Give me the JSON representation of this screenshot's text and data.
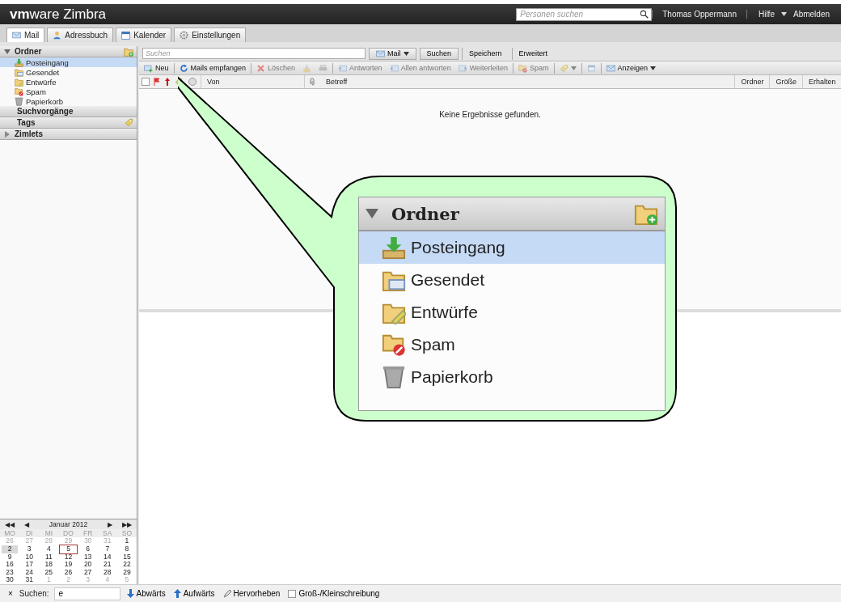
{
  "header": {
    "logo": "**vm**ware Zimbra",
    "people_search": {
      "placeholder": "Personen suchen"
    },
    "user": "Thomas Oppermann",
    "help": "Hilfe",
    "logout": "Abmelden"
  },
  "app_tabs": [
    {
      "label": "Mail",
      "selected": true
    },
    {
      "label": "Adressbuch",
      "selected": false
    },
    {
      "label": "Kalender",
      "selected": false
    },
    {
      "label": "Einstellungen",
      "selected": false
    }
  ],
  "sidebar": {
    "folders_header": {
      "label": "Ordner",
      "expanded": true
    },
    "folders": [
      {
        "label": "Posteingang",
        "selected": true
      },
      {
        "label": "Gesendet",
        "selected": false
      },
      {
        "label": "Entwürfe",
        "selected": false
      },
      {
        "label": "Spam",
        "selected": false
      },
      {
        "label": "Papierkorb",
        "selected": false
      }
    ],
    "sections": [
      {
        "label": "Suchvorgänge",
        "kind": "plain"
      },
      {
        "label": "Tags",
        "kind": "tags"
      },
      {
        "label": "Zimlets",
        "kind": "collapsed"
      }
    ]
  },
  "search": {
    "placeholder": "Suchen",
    "scope": "Mail",
    "buttons": [
      "Suchen",
      "Speichern",
      "Erweitert"
    ]
  },
  "toolbar": [
    {
      "label": "Neu",
      "disabled": false
    },
    {
      "label": "Mails empfangen",
      "disabled": false
    },
    {
      "label": "Löschen",
      "disabled": true
    },
    {
      "disabled": true
    },
    {
      "disabled": true
    },
    {
      "label": "Antworten",
      "disabled": true
    },
    {
      "label": "Allen antworten",
      "disabled": true
    },
    {
      "label": "Weiterleiten",
      "disabled": true
    },
    {
      "label": "Spam",
      "disabled": true
    },
    {
      "disabled": true
    },
    {
      "disabled": true
    },
    {
      "label": "Anzeigen",
      "disabled": false
    }
  ],
  "select_all": {
    "checked": false
  },
  "columns": [
    "Von",
    "Betreff",
    "Ordner",
    "Größe",
    "Erhalten"
  ],
  "empty_message": "Keine Ergebnisse gefunden.",
  "calendar": {
    "nav": [
      "◀◀",
      "◀",
      "▶",
      "▶▶"
    ],
    "title": "Januar 2012",
    "weekdays": [
      "MO",
      "DI",
      "MI",
      "DO",
      "FR",
      "SA",
      "SO"
    ],
    "weeks": [
      [
        {
          "day": "26",
          "other_month": true,
          "today": false,
          "selected": false
        },
        {
          "day": "27",
          "other_month": true,
          "today": false,
          "selected": false
        },
        {
          "day": "28",
          "other_month": true,
          "today": false,
          "selected": false
        },
        {
          "day": "29",
          "other_month": true,
          "today": false,
          "selected": false
        },
        {
          "day": "30",
          "other_month": true,
          "today": false,
          "selected": false
        },
        {
          "day": "31",
          "other_month": true,
          "today": false,
          "selected": false
        },
        {
          "day": "1",
          "other_month": false,
          "today": false,
          "selected": false
        }
      ],
      [
        {
          "day": "2",
          "other_month": false,
          "today": false,
          "selected": true
        },
        {
          "day": "3",
          "other_month": false,
          "today": false,
          "selected": false
        },
        {
          "day": "4",
          "other_month": false,
          "today": false,
          "selected": false
        },
        {
          "day": "5",
          "other_month": false,
          "today": true,
          "selected": false
        },
        {
          "day": "6",
          "other_month": false,
          "today": false,
          "selected": false
        },
        {
          "day": "7",
          "other_month": false,
          "today": false,
          "selected": false
        },
        {
          "day": "8",
          "other_month": false,
          "today": false,
          "selected": false
        }
      ],
      [
        {
          "day": "9",
          "other_month": false,
          "today": false,
          "selected": false
        },
        {
          "day": "10",
          "other_month": false,
          "today": false,
          "selected": false
        },
        {
          "day": "11",
          "other_month": false,
          "today": false,
          "selected": false
        },
        {
          "day": "12",
          "other_month": false,
          "today": false,
          "selected": false
        },
        {
          "day": "13",
          "other_month": false,
          "today": false,
          "selected": false
        },
        {
          "day": "14",
          "other_month": false,
          "today": false,
          "selected": false
        },
        {
          "day": "15",
          "other_month": false,
          "today": false,
          "selected": false
        }
      ],
      [
        {
          "day": "16",
          "other_month": false,
          "today": false,
          "selected": false
        },
        {
          "day": "17",
          "other_month": false,
          "today": false,
          "selected": false
        },
        {
          "day": "18",
          "other_month": false,
          "today": false,
          "selected": false
        },
        {
          "day": "19",
          "other_month": false,
          "today": false,
          "selected": false
        },
        {
          "day": "20",
          "other_month": false,
          "today": false,
          "selected": false
        },
        {
          "day": "21",
          "other_month": false,
          "today": false,
          "selected": false
        },
        {
          "day": "22",
          "other_month": false,
          "today": false,
          "selected": false
        }
      ],
      [
        {
          "day": "23",
          "other_month": false,
          "today": false,
          "selected": false
        },
        {
          "day": "24",
          "other_month": false,
          "today": false,
          "selected": false
        },
        {
          "day": "25",
          "other_month": false,
          "today": false,
          "selected": false
        },
        {
          "day": "26",
          "other_month": false,
          "today": false,
          "selected": false
        },
        {
          "day": "27",
          "other_month": false,
          "today": false,
          "selected": false
        },
        {
          "day": "28",
          "other_month": false,
          "today": false,
          "selected": false
        },
        {
          "day": "29",
          "other_month": false,
          "today": false,
          "selected": false
        }
      ],
      [
        {
          "day": "30",
          "other_month": false,
          "today": false,
          "selected": false
        },
        {
          "day": "31",
          "other_month": false,
          "today": false,
          "selected": false
        },
        {
          "day": "1",
          "other_month": true,
          "today": false,
          "selected": false
        },
        {
          "day": "2",
          "other_month": true,
          "today": false,
          "selected": false
        },
        {
          "day": "3",
          "other_month": true,
          "today": false,
          "selected": false
        },
        {
          "day": "4",
          "other_month": true,
          "today": false,
          "selected": false
        },
        {
          "day": "5",
          "other_month": true,
          "today": false,
          "selected": false
        }
      ]
    ]
  },
  "find_bar": {
    "close": "×",
    "label": "Suchen:",
    "value": "e",
    "down": "Abwärts",
    "up": "Aufwärts",
    "highlight": "Hervorheben",
    "match_case": {
      "label": "Groß-/Kleinschreibung",
      "checked": false
    }
  },
  "callout": {
    "header": {
      "label": "Ordner",
      "expanded": true
    },
    "folders": [
      {
        "label": "Posteingang",
        "selected": true
      },
      {
        "label": "Gesendet",
        "selected": false
      },
      {
        "label": "Entwürfe",
        "selected": false
      },
      {
        "label": "Spam",
        "selected": false
      },
      {
        "label": "Papierkorb",
        "selected": false
      }
    ]
  }
}
